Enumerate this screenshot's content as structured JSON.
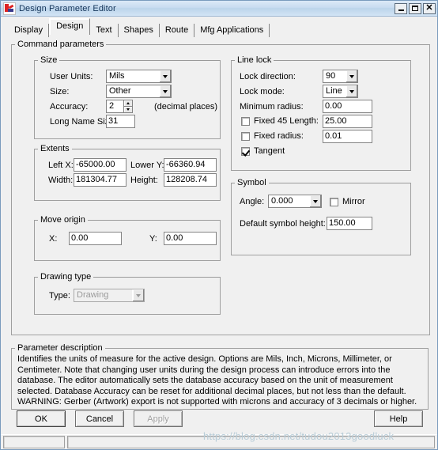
{
  "window": {
    "title": "Design Parameter Editor",
    "icon": "app-icon",
    "minimize_label": "Minimize",
    "maximize_label": "Maximize",
    "close_label": "Close"
  },
  "tabs": [
    {
      "label": "Display",
      "selected": false
    },
    {
      "label": "Design",
      "selected": true
    },
    {
      "label": "Text",
      "selected": false
    },
    {
      "label": "Shapes",
      "selected": false
    },
    {
      "label": "Route",
      "selected": false
    },
    {
      "label": "Mfg Applications",
      "selected": false
    }
  ],
  "command_parameters": {
    "legend": "Command parameters",
    "size": {
      "legend": "Size",
      "user_units_label": "User Units:",
      "user_units_value": "Mils",
      "size_label": "Size:",
      "size_value": "Other",
      "accuracy_label": "Accuracy:",
      "accuracy_value": "2",
      "accuracy_suffix": "(decimal places)",
      "long_name_size_label": "Long Name Size:",
      "long_name_size_value": "31"
    },
    "extents": {
      "legend": "Extents",
      "left_x_label": "Left X:",
      "left_x_value": "-65000.00",
      "lower_y_label": "Lower Y:",
      "lower_y_value": "-66360.94",
      "width_label": "Width:",
      "width_value": "181304.77",
      "height_label": "Height:",
      "height_value": "128208.74"
    },
    "move_origin": {
      "legend": "Move origin",
      "x_label": "X:",
      "x_value": "0.00",
      "y_label": "Y:",
      "y_value": "0.00"
    },
    "drawing_type": {
      "legend": "Drawing type",
      "type_label": "Type:",
      "type_value": "Drawing"
    },
    "line_lock": {
      "legend": "Line lock",
      "lock_direction_label": "Lock direction:",
      "lock_direction_value": "90",
      "lock_mode_label": "Lock mode:",
      "lock_mode_value": "Line",
      "minimum_radius_label": "Minimum radius:",
      "minimum_radius_value": "0.00",
      "fixed_45_label": "Fixed 45 Length:",
      "fixed_45_value": "25.00",
      "fixed_45_checked": false,
      "fixed_radius_label": "Fixed radius:",
      "fixed_radius_value": "0.01",
      "fixed_radius_checked": false,
      "tangent_label": "Tangent",
      "tangent_checked": true
    },
    "symbol": {
      "legend": "Symbol",
      "angle_label": "Angle:",
      "angle_value": "0.000",
      "mirror_label": "Mirror",
      "mirror_checked": false,
      "default_symbol_height_label": "Default symbol height:",
      "default_symbol_height_value": "150.00"
    }
  },
  "parameter_description": {
    "legend": "Parameter description",
    "text": "Identifies the units of measure for the active design. Options are Mils, Inch, Microns, Millimeter, or Centimeter. Note that changing user units during the design process can introduce errors into the database.  The editor automatically sets the database accuracy based on the unit of measurement selected. Database Accuracy can be reset for additional decimal places, but not less than the default. WARNING: Gerber (Artwork) export is not supported with microns and accuracy of 3 decimals or higher."
  },
  "buttons": {
    "ok": "OK",
    "cancel": "Cancel",
    "apply": "Apply",
    "help": "Help"
  },
  "watermark": "https://blog.csdn.net/tudou2013goodluck"
}
